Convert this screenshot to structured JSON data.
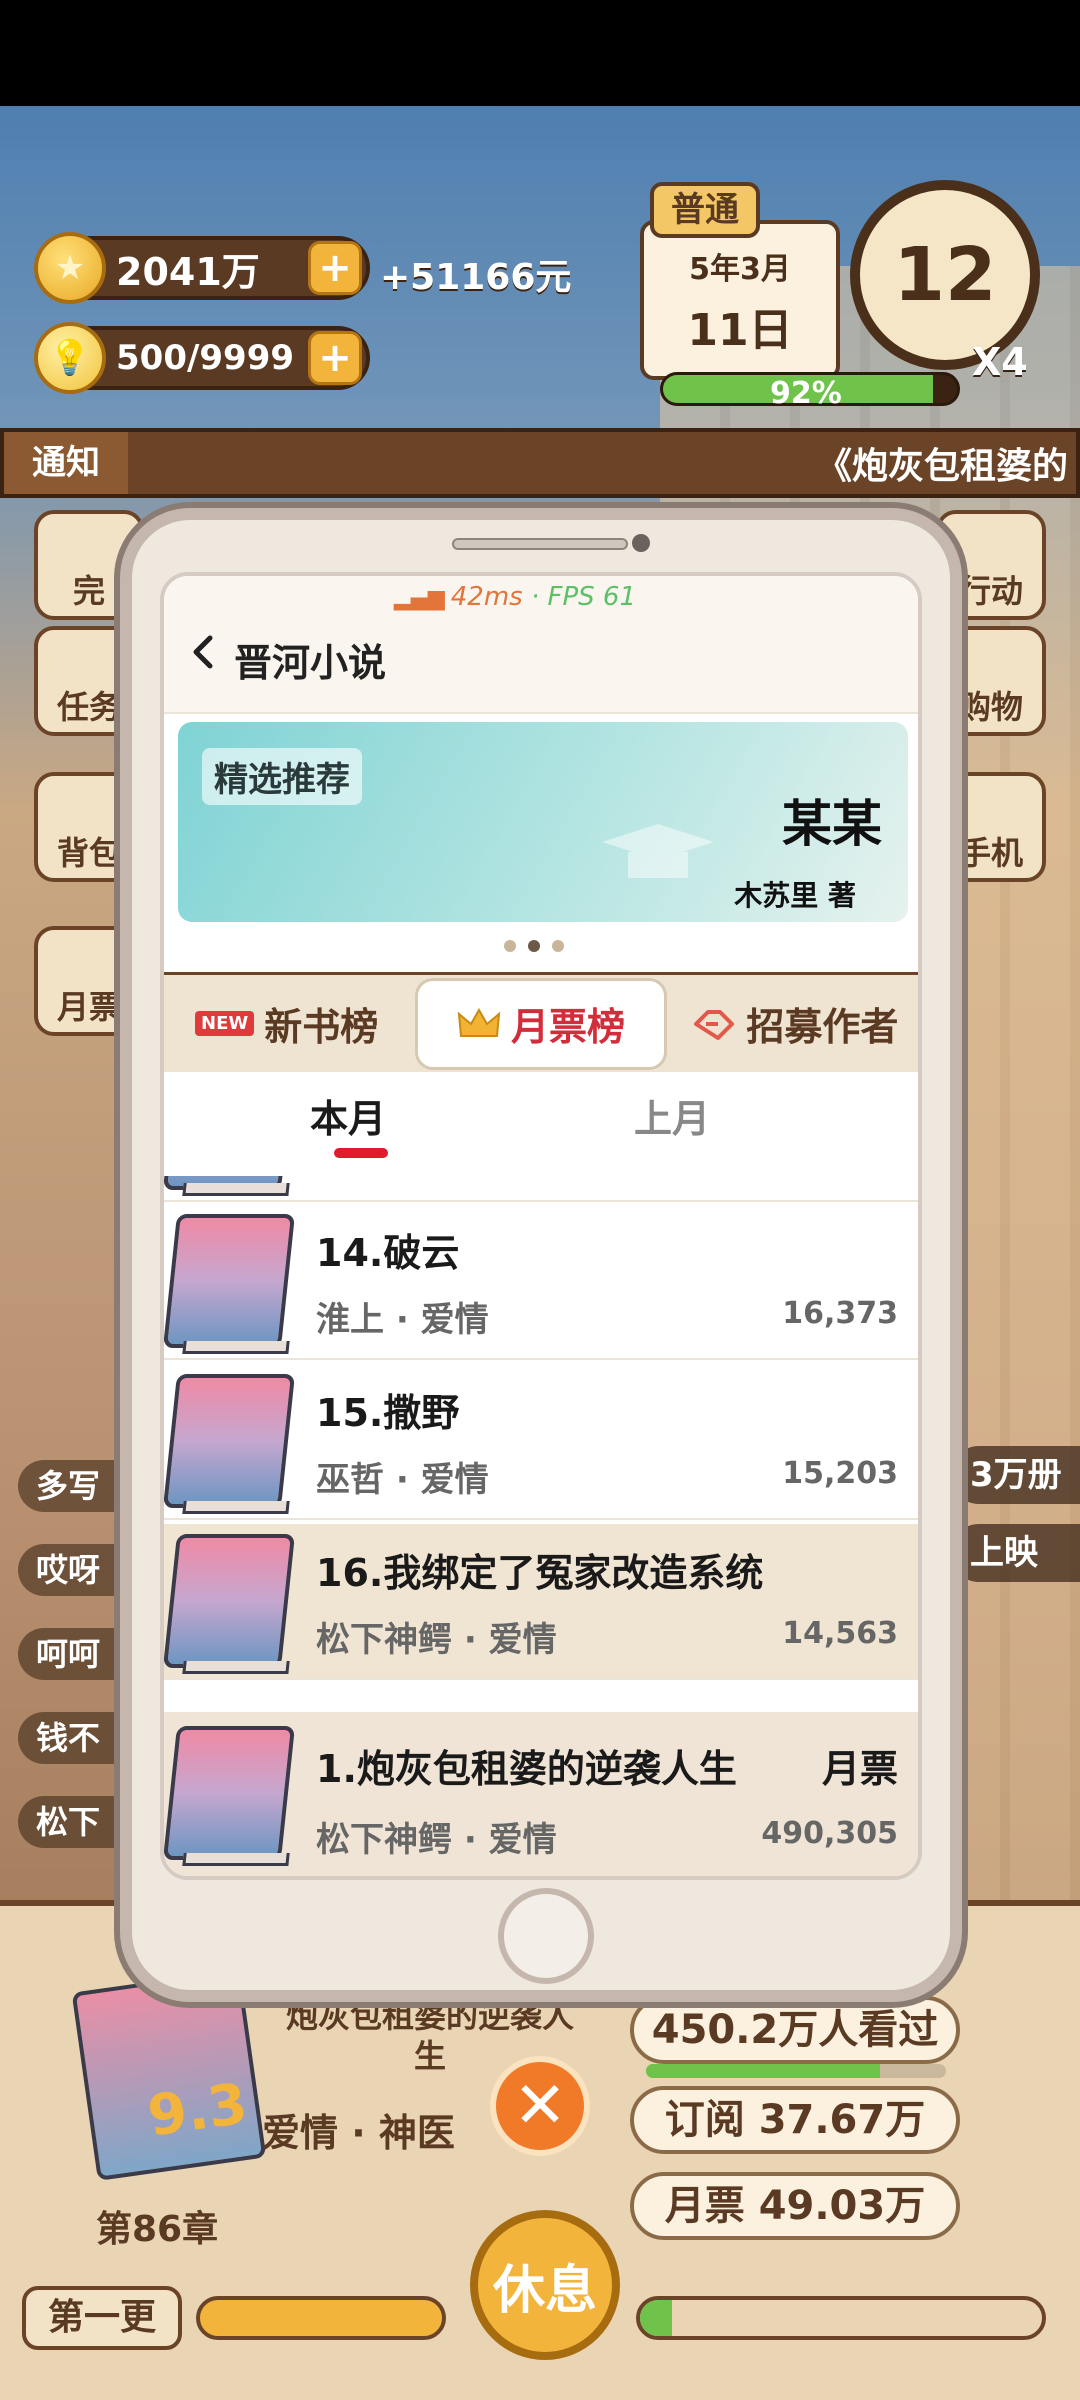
{
  "hud": {
    "money": "2041万",
    "income": "+51166元",
    "ideas": "500/9999",
    "mode": "普通",
    "date_month": "5年3月",
    "date_day": "11日",
    "clock": "12",
    "speed": "X4",
    "energy": "92%",
    "energy_fraction": 0.92
  },
  "notice": {
    "label": "通知",
    "text": "《炮灰包租婆的"
  },
  "side": {
    "left_buttons": [
      "完",
      "任务",
      "背包",
      "月票"
    ],
    "right_buttons": [
      "行动",
      "购物",
      "手机"
    ],
    "left_tags": [
      "多写",
      "哎呀",
      "呵呵",
      "钱不",
      "松下"
    ],
    "right_tags": [
      "3万册",
      "上映"
    ]
  },
  "phone": {
    "fps": {
      "ms": "42ms",
      "sep": " · ",
      "fps": "FPS 61"
    },
    "app_title": "晋河小说",
    "banner": {
      "tag": "精选推荐",
      "book_title": "某某",
      "author": "木苏里 著"
    },
    "tabs": [
      {
        "label": "新书榜",
        "badge": "NEW"
      },
      {
        "label": "月票榜"
      },
      {
        "label": "招募作者"
      }
    ],
    "subtabs": [
      "本月",
      "上月"
    ],
    "rows": [
      {
        "title": "14.破云",
        "meta": "淮上 · 爱情",
        "votes": "16,373"
      },
      {
        "title": "15.撒野",
        "meta": "巫哲 · 爱情",
        "votes": "15,203"
      },
      {
        "title": "16.我绑定了冤家改造系统",
        "meta": "松下神鳄 · 爱情",
        "votes": "14,563"
      }
    ],
    "mine": {
      "title": "1.炮灰包租婆的逆袭人生",
      "label": "月票",
      "meta": "松下神鳄 · 爱情",
      "votes": "490,305"
    }
  },
  "bottom": {
    "book_title": "炮灰包租婆的逆袭人生",
    "rating": "9.3",
    "genre": "爱情 · 神医",
    "chapter": "第86章",
    "views": "450.2万人看过",
    "views_fraction": 0.78,
    "subscribe": "订阅 37.67万",
    "monthly": "月票 49.03万",
    "rest": "休息",
    "first_update": "第一更",
    "writing_progress": 0.08
  }
}
